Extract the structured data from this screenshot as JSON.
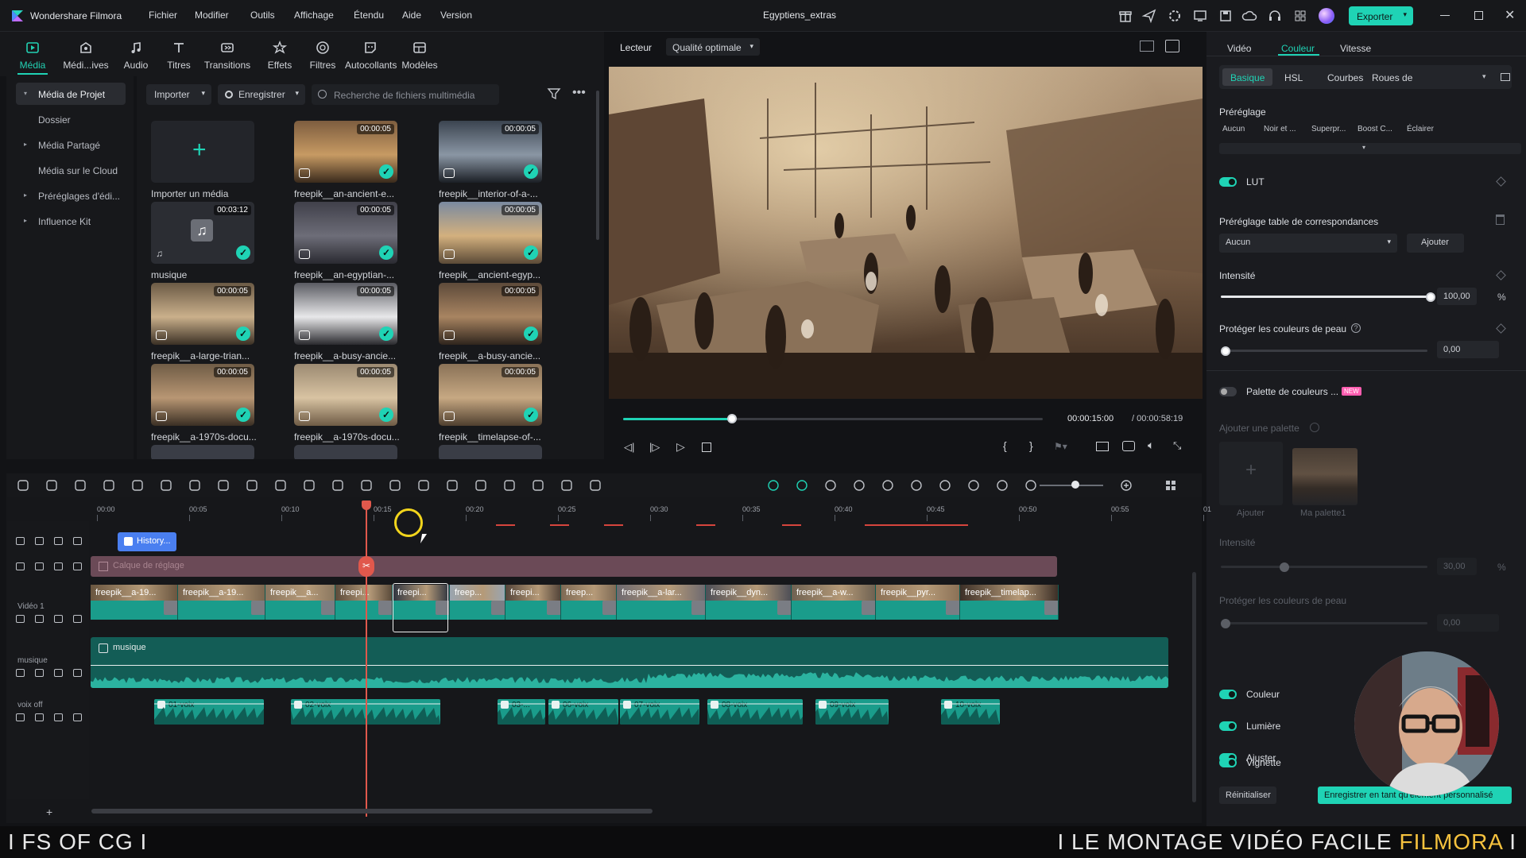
{
  "app": {
    "name": "Wondershare Filmora",
    "project_title": "Egyptiens_extras",
    "export_label": "Exporter"
  },
  "menu": [
    "Fichier",
    "Modifier",
    "Outils",
    "Affichage",
    "Étendu",
    "Aide",
    "Version"
  ],
  "toolbar": [
    {
      "label": "Média",
      "icon": "media-icon",
      "active": true
    },
    {
      "label": "Médi...ives",
      "icon": "stock-media-icon"
    },
    {
      "label": "Audio",
      "icon": "music-note-icon"
    },
    {
      "label": "Titres",
      "icon": "text-icon"
    },
    {
      "label": "Transitions",
      "icon": "transitions-icon"
    },
    {
      "label": "Effets",
      "icon": "effects-icon"
    },
    {
      "label": "Filtres",
      "icon": "filters-icon"
    },
    {
      "label": "Autocollants",
      "icon": "stickers-icon"
    },
    {
      "label": "Modèles",
      "icon": "templates-icon"
    }
  ],
  "sidebar": [
    {
      "label": "Média de Projet",
      "caret": "▾",
      "selected": true
    },
    {
      "label": "Dossier",
      "caret": ""
    },
    {
      "label": "Média Partagé",
      "caret": "▸"
    },
    {
      "label": "Média sur le Cloud",
      "caret": ""
    },
    {
      "label": "Préréglages d'édi...",
      "caret": "▸"
    },
    {
      "label": "Influence Kit",
      "caret": "▸"
    }
  ],
  "media_bar": {
    "import": "Importer",
    "record": "Enregistrer",
    "search_placeholder": "Recherche de fichiers multimédia"
  },
  "media": [
    {
      "name": "Importer un média",
      "import": true
    },
    {
      "name": "freepik__an-ancient-e...",
      "dur": "00:00:05"
    },
    {
      "name": "freepik__interior-of-a-...",
      "dur": "00:00:05"
    },
    {
      "name": "musique",
      "dur": "00:03:12",
      "audio": true
    },
    {
      "name": "freepik__an-egyptian-...",
      "dur": "00:00:05"
    },
    {
      "name": "freepik__ancient-egyp...",
      "dur": "00:00:05"
    },
    {
      "name": "freepik__a-large-trian...",
      "dur": "00:00:05"
    },
    {
      "name": "freepik__a-busy-ancie...",
      "dur": "00:00:05"
    },
    {
      "name": "freepik__a-busy-ancie...",
      "dur": "00:00:05"
    },
    {
      "name": "freepik__a-1970s-docu...",
      "dur": "00:00:05"
    },
    {
      "name": "freepik__a-1970s-docu...",
      "dur": "00:00:05"
    },
    {
      "name": "freepik__timelapse-of-...",
      "dur": "00:00:05"
    }
  ],
  "player": {
    "label": "Lecteur",
    "quality": "Qualité optimale",
    "current": "00:00:15:00",
    "total": "/ 00:00:58:19",
    "progress": 0.26
  },
  "inspector": {
    "tabs": [
      "Vidéo",
      "Couleur",
      "Vitesse"
    ],
    "active_tab": "Couleur",
    "subtabs": [
      "Basique",
      "HSL",
      "Courbes",
      "Roues de"
    ],
    "preset_title": "Préréglage",
    "presets": [
      "Aucun",
      "Noir et ...",
      "Superpr...",
      "Boost C...",
      "Éclairer"
    ],
    "lut": "LUT",
    "lut_preset_title": "Préréglage table de correspondances",
    "lut_value": "Aucun",
    "lut_add": "Ajouter",
    "intensity_label": "Intensité",
    "intensity_value": "100,00",
    "pct": "%",
    "skin_label": "Protéger les couleurs de peau",
    "skin_value": "0,00",
    "palette_label": "Palette de couleurs ...",
    "new_badge": "NEW",
    "add_palette": "Ajouter une palette",
    "add_label": "Ajouter",
    "my_palette": "Ma palette1",
    "intensity2_value": "30,00",
    "skin2_value": "0,00",
    "sections": [
      "Couleur",
      "Lumière",
      "Ajuster",
      "Vignette"
    ],
    "reset": "Réinitialiser",
    "save": "Enregistrer en tant qu'élément personnalisé"
  },
  "timeline": {
    "ruler": [
      "00:00",
      "00:05",
      "00:10",
      "00:15",
      "00:20",
      "00:25",
      "00:30",
      "00:35",
      "00:40",
      "00:45",
      "00:50",
      "00:55",
      "01"
    ],
    "title_clip": "History...",
    "adjust_clip": "Calque de réglage",
    "video_track": "Vidéo 1",
    "video_clips": [
      "freepik__a-19...",
      "freepik__a-19...",
      "freepik__a...",
      "freepi...",
      "freepi...",
      "freep...",
      "freepi...",
      "freep...",
      "freepik__a-lar...",
      "freepik__dyn...",
      "freepik__a-w...",
      "freepik__pyr...",
      "freepik__timelap..."
    ],
    "music_track": "musique",
    "music_clip": "musique",
    "voice_track": "voix off",
    "voice_clips": [
      "01-voix",
      "02-voix",
      "03-...",
      "06-voix",
      "07-voix",
      "08-voix",
      "09-voix",
      "10-voix"
    ]
  },
  "banner": {
    "left": "I FS OF CG I",
    "right_a": "I LE MONTAGE VIDÉO FACILE ",
    "right_b": "FILMORA",
    "right_c": " I"
  }
}
